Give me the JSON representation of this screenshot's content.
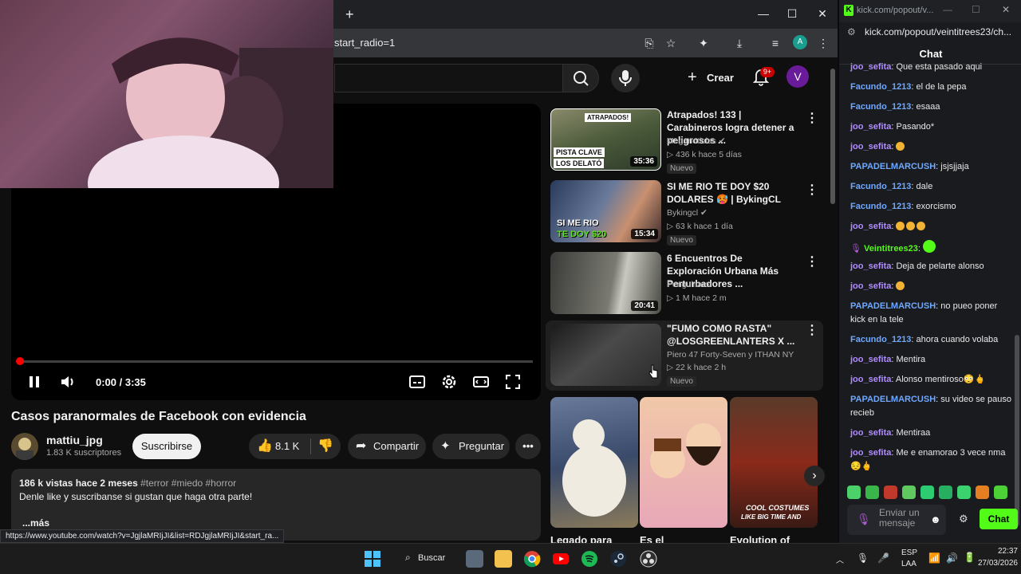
{
  "browser": {
    "new_tab_icon": "plus-icon",
    "url_fragment": "start_radio=1",
    "profile_letter": "A"
  },
  "youtube": {
    "create_label": "Crear",
    "notification_count": "9+",
    "avatar_letter": "V",
    "player": {
      "time": "0:00 / 3:35",
      "progress_fraction": 0.0
    },
    "video": {
      "title": "Casos paranormales de Facebook con evidencia",
      "channel": "mattiu_jpg",
      "subscribers": "1.83 K suscriptores",
      "subscribe_label": "Suscribirse",
      "likes": "8.1 K",
      "share_label": "Compartir",
      "ask_label": "Preguntar"
    },
    "description": {
      "meta": "186 k vistas  hace 2 meses",
      "tags": "#terror #miedo #horror",
      "text": "Denle like y suscribanse si gustan que haga otra parte!",
      "more": "...más"
    },
    "status_url": "https://www.youtube.com/watch?v=JgjlaMRIjJI&list=RDJgjlaMRIjJI&start_ra...",
    "recommendations": [
      {
        "title": "Atrapados! 133 | Carabineros logra detener a peligrosos ...",
        "channel": "Meganoticias",
        "stats": "▷ 436 k   hace 5 días",
        "badge": "Nuevo",
        "duration": "35:36",
        "thumb_text_1": "ATRAPADOS!",
        "thumb_text_2": "PISTA CLAVE",
        "thumb_text_3": "LOS DELATÓ"
      },
      {
        "title": "SI ME RIO TE DOY $20 DOLARES 🥵 | BykingCL",
        "channel": "Bykingcl",
        "stats": "▷ 63 k   hace 1 día",
        "badge": "Nuevo",
        "duration": "15:34",
        "thumb_text_1": "SI ME RIO",
        "thumb_text_2": "TE DOY $20"
      },
      {
        "title": "6 Encuentros De Exploración Urbana Más Perturbadores ...",
        "channel": "Penguinator",
        "stats": "▷ 1 M   hace 2 m",
        "duration": "20:41"
      },
      {
        "title": "\"FUMO COMO RASTA\" @LOSGREENLANTERS X ...",
        "channel": "Piero 47 Forty-Seven  y ITHAN NY",
        "stats": "▷ 22 k   hace 2 h",
        "badge": "Nuevo"
      }
    ],
    "shorts": [
      {
        "title": "Legado para"
      },
      {
        "title": "Es el"
      },
      {
        "title": "Evolution of",
        "overlay_1": "COOL COSTUMES",
        "overlay_2": "LIKE BIG TIME AND"
      }
    ]
  },
  "kick": {
    "window_title": "kick.com/popout/v...",
    "url": "kick.com/popout/veintitrees23/ch...",
    "chat_title": "Chat",
    "messages": [
      {
        "user": "joo_sefita",
        "text": "Que esta pasado aqui",
        "color": "#b18cff"
      },
      {
        "user": "Facundo_1213",
        "text": "el de la pepa",
        "color": "#6fa8ff"
      },
      {
        "user": "Facundo_1213",
        "text": "esaaa",
        "color": "#6fa8ff"
      },
      {
        "user": "joo_sefita",
        "text": "Pasando*",
        "color": "#b18cff"
      },
      {
        "user": "joo_sefita",
        "text": "",
        "color": "#b18cff",
        "emojis": 1
      },
      {
        "user": "PAPADELMARCUSH",
        "text": "jsjsjjaja",
        "color": "#6fa8ff"
      },
      {
        "user": "Facundo_1213",
        "text": "dale",
        "color": "#6fa8ff"
      },
      {
        "user": "Facundo_1213",
        "text": "exorcismo",
        "color": "#6fa8ff"
      },
      {
        "user": "joo_sefita",
        "text": "",
        "color": "#b18cff",
        "emojis": 3
      },
      {
        "user": "Veintitrees23",
        "text": "",
        "color": "#53fc18",
        "emojis": 1
      },
      {
        "user": "joo_sefita",
        "text": "Deja de pelarte alonso",
        "color": "#b18cff"
      },
      {
        "user": "joo_sefita",
        "text": "",
        "color": "#b18cff",
        "emojis": 1
      },
      {
        "user": "PAPADELMARCUSH",
        "text": "no pueo poner kick en la tele",
        "color": "#6fa8ff"
      },
      {
        "user": "Facundo_1213",
        "text": "ahora cuando volaba",
        "color": "#6fa8ff"
      },
      {
        "user": "joo_sefita",
        "text": "Mentira",
        "color": "#b18cff"
      },
      {
        "user": "joo_sefita",
        "text": "Alonso mentiroso😳🖕",
        "color": "#b18cff"
      },
      {
        "user": "PAPADELMARCUSH",
        "text": "su video se pauso recieb",
        "color": "#6fa8ff"
      },
      {
        "user": "joo_sefita",
        "text": "Mentiraa",
        "color": "#b18cff"
      },
      {
        "user": "joo_sefita",
        "text": "Me e enamorao 3 vece nma😔🖕",
        "color": "#b18cff"
      }
    ],
    "input_placeholder": "Enviar un mensaje",
    "send_label": "Chat"
  },
  "taskbar": {
    "search_label": "Buscar",
    "language": "ESP",
    "layout": "LAA",
    "time": "22:37",
    "date": "27/03/2026"
  }
}
